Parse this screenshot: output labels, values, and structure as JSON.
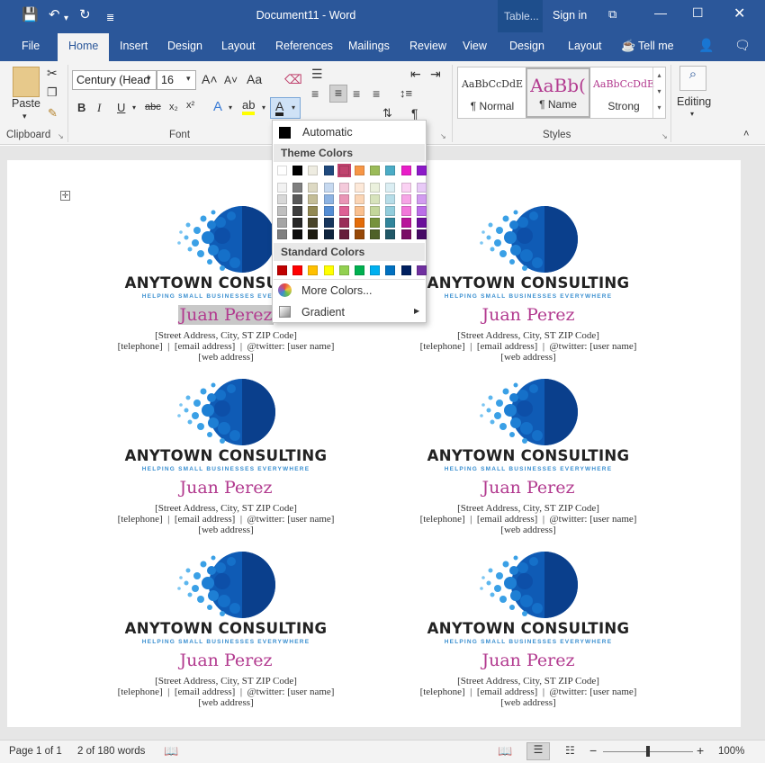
{
  "title_bar": {
    "document_title": "Document11 - Word",
    "context_tab": "Table...",
    "sign_in": "Sign in"
  },
  "ribbon_tabs": [
    {
      "label": "File",
      "active": false
    },
    {
      "label": "Home",
      "active": true
    },
    {
      "label": "Insert",
      "active": false
    },
    {
      "label": "Design",
      "active": false
    },
    {
      "label": "Layout",
      "active": false
    },
    {
      "label": "References",
      "active": false
    },
    {
      "label": "Mailings",
      "active": false
    },
    {
      "label": "Review",
      "active": false
    },
    {
      "label": "View",
      "active": false
    },
    {
      "label": "Design",
      "active": false
    },
    {
      "label": "Layout",
      "active": false
    }
  ],
  "tell_me": "Tell me",
  "clipboard": {
    "paste_label": "Paste",
    "group_label": "Clipboard"
  },
  "font_group": {
    "font_name": "Century (Head",
    "font_size": "16",
    "group_label": "Font",
    "change_case": "Aa"
  },
  "styles_group": {
    "group_label": "Styles",
    "items": [
      {
        "preview": "AaBbCcDdE",
        "name": "¶ Normal",
        "selected": false
      },
      {
        "preview": "AaBb(",
        "name": "¶ Name",
        "selected": true
      },
      {
        "preview": "AaBbCcDdE",
        "name": "Strong",
        "selected": false
      }
    ]
  },
  "editing": {
    "label": "Editing"
  },
  "color_menu": {
    "automatic": "Automatic",
    "theme_header": "Theme Colors",
    "standard_header": "Standard Colors",
    "more_colors": "More Colors...",
    "gradient": "Gradient",
    "theme_top": [
      "#ffffff",
      "#000000",
      "#eeece1",
      "#1f497d",
      "#c0436e",
      "#f79646",
      "#9bbb59",
      "#4bacc6",
      "#e91ec8",
      "#8c1ac8"
    ],
    "theme_shades": [
      [
        "#f2f2f2",
        "#7f7f7f",
        "#ddd9c3",
        "#c6d9f0",
        "#f4cadb",
        "#fde9d9",
        "#ebf1dd",
        "#dbeef3",
        "#fbd2f3",
        "#e8caf7"
      ],
      [
        "#d8d8d8",
        "#595959",
        "#c4bd97",
        "#8db3e2",
        "#e995b6",
        "#fbd5b5",
        "#d7e3bc",
        "#b7dde8",
        "#f6a5e6",
        "#d29cf0"
      ],
      [
        "#bfbfbf",
        "#3f3f3f",
        "#938953",
        "#548dd4",
        "#dd6094",
        "#fac08f",
        "#c3d69b",
        "#92cddc",
        "#f277da",
        "#bb6ee8"
      ],
      [
        "#a5a5a5",
        "#262626",
        "#494429",
        "#17365d",
        "#9a2d58",
        "#e36c09",
        "#76923c",
        "#31859b",
        "#b8139a",
        "#6a0f9a"
      ],
      [
        "#7f7f7f",
        "#0c0c0c",
        "#1d1b10",
        "#0f243e",
        "#661e3a",
        "#974806",
        "#4f6128",
        "#205867",
        "#7a0d66",
        "#460a66"
      ]
    ],
    "standard": [
      "#c00000",
      "#ff0000",
      "#ffc000",
      "#ffff00",
      "#92d050",
      "#00b050",
      "#00b0f0",
      "#0070c0",
      "#002060",
      "#7030a0"
    ]
  },
  "cards": [
    {
      "company": "ANYTOWN CONSULTING",
      "tagline": "HELPING SMALL BUSINESSES EVERYWHERE",
      "name": "Juan Perez",
      "address": "[Street Address, City, ST  ZIP Code]",
      "contact": "[telephone]  |  [email address]  |  @twitter: [user name]",
      "web": "[web address]"
    },
    {
      "company": "ANYTOWN CONSULTING",
      "tagline": "HELPING SMALL BUSINESSES EVERYWHERE",
      "name": "Juan Perez",
      "address": "[Street Address, City, ST  ZIP Code]",
      "contact": "[telephone]  |  [email address]  |  @twitter: [user name]",
      "web": "[web address]"
    },
    {
      "company": "ANYTOWN CONSULTING",
      "tagline": "HELPING SMALL BUSINESSES EVERYWHERE",
      "name": "Juan Perez",
      "address": "[Street Address, City, ST  ZIP Code]",
      "contact": "[telephone]  |  [email address]  |  @twitter: [user name]",
      "web": "[web address]"
    },
    {
      "company": "ANYTOWN CONSULTING",
      "tagline": "HELPING SMALL BUSINESSES EVERYWHERE",
      "name": "Juan Perez",
      "address": "[Street Address, City, ST  ZIP Code]",
      "contact": "[telephone]  |  [email address]  |  @twitter: [user name]",
      "web": "[web address]"
    },
    {
      "company": "ANYTOWN CONSULTING",
      "tagline": "HELPING SMALL BUSINESSES EVERYWHERE",
      "name": "Juan Perez",
      "address": "[Street Address, City, ST  ZIP Code]",
      "contact": "[telephone]  |  [email address]  |  @twitter: [user name]",
      "web": "[web address]"
    },
    {
      "company": "ANYTOWN CONSULTING",
      "tagline": "HELPING SMALL BUSINESSES EVERYWHERE",
      "name": "Juan Perez",
      "address": "[Street Address, City, ST  ZIP Code]",
      "contact": "[telephone]  |  [email address]  |  @twitter: [user name]",
      "web": "[web address]"
    }
  ],
  "status_bar": {
    "page": "Page 1 of 1",
    "words": "2 of 180 words",
    "zoom": "100%"
  }
}
